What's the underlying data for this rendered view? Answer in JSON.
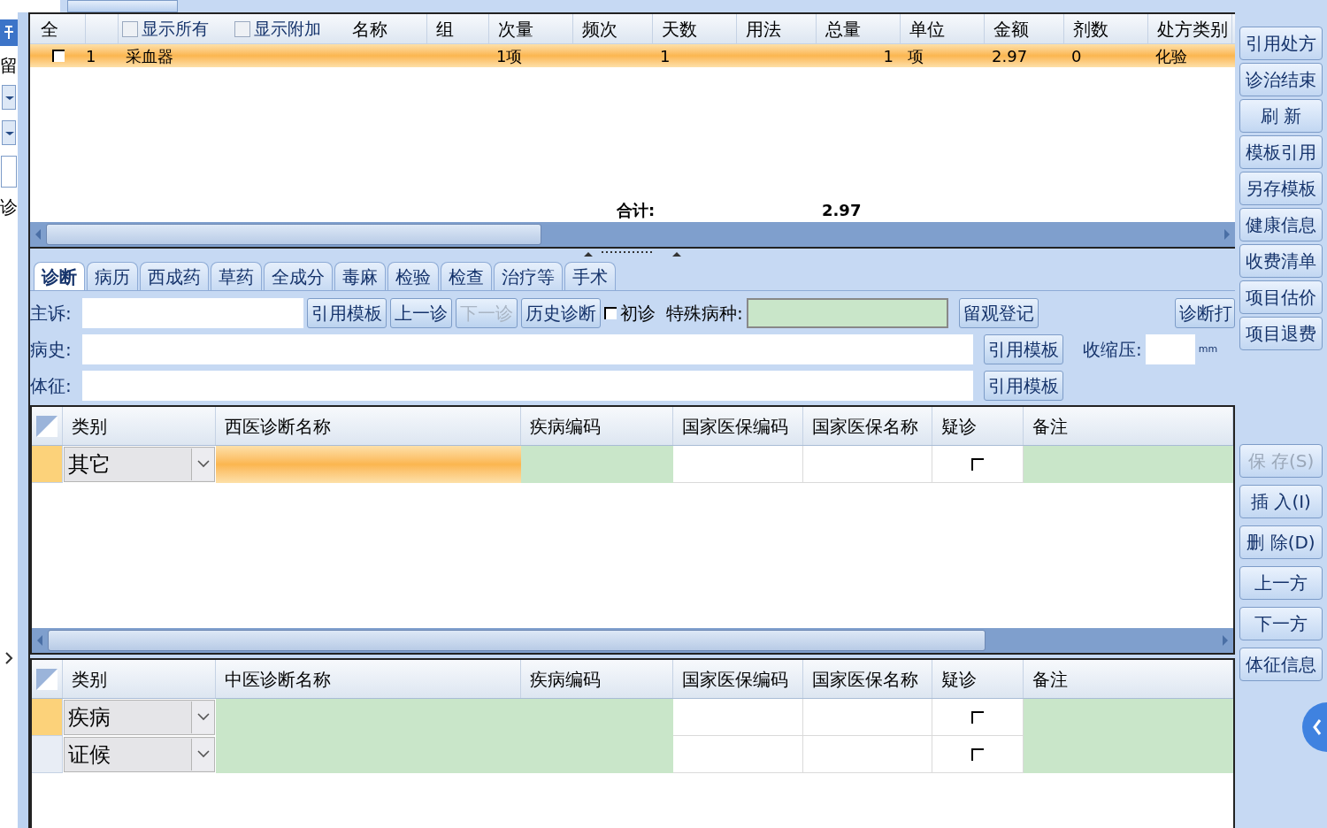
{
  "left_strip": {
    "items": [
      {
        "kind": "pin"
      },
      {
        "kind": "text",
        "label": "留"
      },
      {
        "kind": "dropdown"
      },
      {
        "kind": "dropdown"
      },
      {
        "kind": "field"
      },
      {
        "kind": "text",
        "label": "诊"
      },
      {
        "kind": "chevron"
      }
    ]
  },
  "prescription": {
    "select_all": "全",
    "options": [
      {
        "label": "显示所有",
        "checked": false
      },
      {
        "label": "显示附加",
        "checked": false
      }
    ],
    "columns": [
      "名称",
      "组",
      "次量",
      "频次",
      "天数",
      "用法",
      "总量",
      "单位",
      "金额",
      "剂数",
      "处方类别"
    ],
    "rows": [
      {
        "checked": false,
        "selected": true,
        "index": "1",
        "cells": [
          "采血器",
          "",
          "1项",
          "",
          "1",
          "",
          "1",
          "项",
          "2.97",
          "0",
          "化验"
        ]
      }
    ],
    "total_label": "合计:",
    "total_value": "2.97"
  },
  "tabs": [
    {
      "label": "诊断",
      "selected": true
    },
    {
      "label": "病历",
      "selected": false
    },
    {
      "label": "西成药",
      "selected": false
    },
    {
      "label": "草药",
      "selected": false
    },
    {
      "label": "全成分",
      "selected": false
    },
    {
      "label": "毒麻",
      "selected": false
    },
    {
      "label": "检验",
      "selected": false
    },
    {
      "label": "检查",
      "selected": false
    },
    {
      "label": "治疗等",
      "selected": false
    },
    {
      "label": "手术",
      "selected": false
    }
  ],
  "form": {
    "chief_complaint": {
      "label": "主诉:"
    },
    "buttons": [
      {
        "label": "引用模板",
        "disabled": false
      },
      {
        "label": "上一诊",
        "disabled": false
      },
      {
        "label": "下一诊",
        "disabled": true
      },
      {
        "label": "历史诊断",
        "disabled": false
      }
    ],
    "first_visit": {
      "label": "初诊",
      "checked": false
    },
    "special_disease": {
      "label": "特殊病种:"
    },
    "observation_button": "留观登记",
    "print_button": "诊断打",
    "history": {
      "label": "病史:",
      "button": "引用模板"
    },
    "signs": {
      "label": "体征:",
      "button": "引用模板"
    },
    "systolic": {
      "label": "收缩压:",
      "unit": "mm"
    }
  },
  "western_grid": {
    "columns": [
      "类别",
      "西医诊断名称",
      "疾病编码",
      "国家医保编码",
      "国家医保名称",
      "疑诊",
      "备注"
    ],
    "rows": [
      {
        "category": "其它",
        "selected": true,
        "suspected": false
      }
    ]
  },
  "tcm_grid": {
    "columns": [
      "类别",
      "中医诊断名称",
      "疾病编码",
      "国家医保编码",
      "国家医保名称",
      "疑诊",
      "备注"
    ],
    "rows": [
      {
        "category": "疾病",
        "selected": true,
        "suspected": false
      },
      {
        "category": "证候",
        "selected": false,
        "suspected": false
      }
    ]
  },
  "sidebar": {
    "top_buttons": [
      {
        "label": "引用处方",
        "disabled": false
      },
      {
        "label": "诊治结束",
        "disabled": false
      },
      {
        "label": "刷 新",
        "disabled": false
      },
      {
        "label": "模板引用",
        "disabled": false
      },
      {
        "label": "另存模板",
        "disabled": false
      },
      {
        "label": "健康信息",
        "disabled": false
      },
      {
        "label": "收费清单",
        "disabled": false
      },
      {
        "label": "项目估价",
        "disabled": false
      },
      {
        "label": "项目退费",
        "disabled": false
      }
    ],
    "bottom_buttons": [
      {
        "label": "保 存(S)",
        "disabled": true
      },
      {
        "label": "插 入(I)",
        "disabled": false
      },
      {
        "label": "删 除(D)",
        "disabled": false
      },
      {
        "label": "上一方",
        "disabled": false
      },
      {
        "label": "下一方",
        "disabled": false
      },
      {
        "label": "体征信息",
        "disabled": false
      }
    ]
  }
}
